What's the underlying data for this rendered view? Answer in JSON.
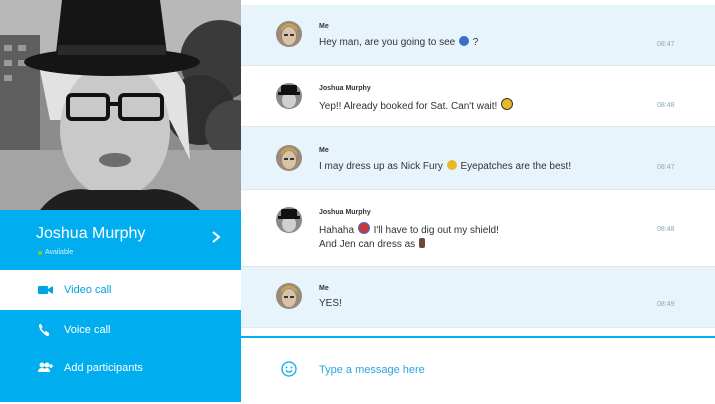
{
  "contact": {
    "name": "Joshua Murphy",
    "status": "Available"
  },
  "actions": [
    {
      "label": "Video call",
      "icon": "video-camera-icon",
      "selected": true
    },
    {
      "label": "Voice call",
      "icon": "phone-icon",
      "selected": false
    },
    {
      "label": "Add participants",
      "icon": "add-participants-icon",
      "selected": false
    }
  ],
  "messages": [
    {
      "sender": "Me",
      "pre": "Hey man, are you going to see",
      "emoji": "movie-emoji",
      "post": " ?",
      "line2": "",
      "emoji2": "",
      "time": "08:47"
    },
    {
      "sender": "Joshua Murphy",
      "pre": "Yep!! Already booked for Sat. Can't wait!",
      "emoji": "grin-emoji",
      "post": "",
      "line2": "",
      "emoji2": "",
      "time": "08:48"
    },
    {
      "sender": "Me",
      "pre": "I may dress up as Nick Fury",
      "emoji": "wink-emoji",
      "post": " Eyepatches are the best!",
      "line2": "",
      "emoji2": "",
      "time": "08:47"
    },
    {
      "sender": "Joshua Murphy",
      "pre": "Hahaha",
      "emoji": "shield-emoji",
      "post": " I'll have to dig out my shield!",
      "line2": "And Jen can dress as",
      "emoji2": "character-emoji",
      "time": "08:48"
    },
    {
      "sender": "Me",
      "pre": "YES!",
      "emoji": "",
      "post": "",
      "line2": "",
      "emoji2": "",
      "time": "08:49"
    }
  ],
  "composer": {
    "placeholder": "Type a message here",
    "emoticon_icon": "smiley-icon"
  },
  "colors": {
    "accent": "#00adef",
    "my_message_bg": "#e8f4fb",
    "presence": "#7ed321"
  }
}
